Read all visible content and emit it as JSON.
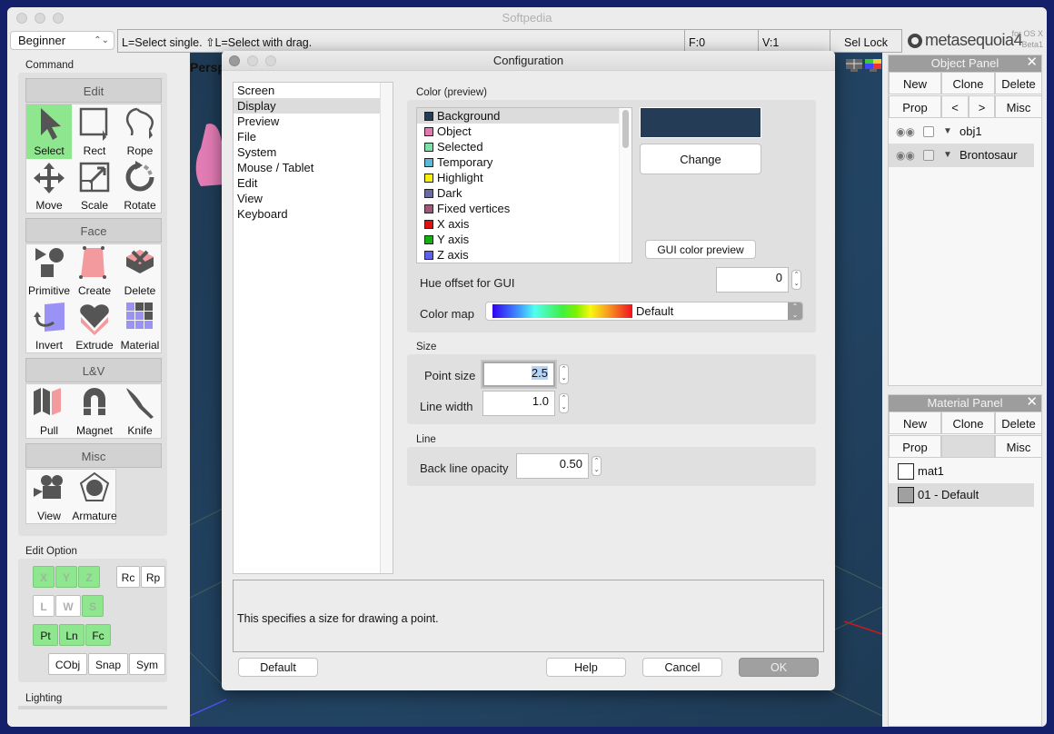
{
  "app": {
    "title": "Softpedia",
    "mode": "Beginner",
    "hint": "L=Select single.  ⇧L=Select with drag.",
    "faces": "F:0",
    "vertices": "V:1",
    "sel_lock": "Sel Lock",
    "logo_name": "metasequoia4",
    "logo_platform": "for OS X",
    "logo_version": "Beta1"
  },
  "command": {
    "label": "Command",
    "groups": [
      {
        "title": "Edit",
        "tools": [
          {
            "label": "Select",
            "icon": "cursor-icon",
            "active": true
          },
          {
            "label": "Rect",
            "icon": "rect-select-icon"
          },
          {
            "label": "Rope",
            "icon": "lasso-icon"
          },
          {
            "label": "Move",
            "icon": "move-icon"
          },
          {
            "label": "Scale",
            "icon": "scale-icon"
          },
          {
            "label": "Rotate",
            "icon": "rotate-icon"
          }
        ]
      },
      {
        "title": "Face",
        "tools": [
          {
            "label": "Primitive",
            "icon": "primitive-icon"
          },
          {
            "label": "Create",
            "icon": "create-face-icon"
          },
          {
            "label": "Delete",
            "icon": "delete-face-icon"
          },
          {
            "label": "Invert",
            "icon": "invert-icon"
          },
          {
            "label": "Extrude",
            "icon": "extrude-icon"
          },
          {
            "label": "Material",
            "icon": "material-icon"
          }
        ]
      },
      {
        "title": "L&V",
        "tools": [
          {
            "label": "Pull",
            "icon": "pull-icon"
          },
          {
            "label": "Magnet",
            "icon": "magnet-icon"
          },
          {
            "label": "Knife",
            "icon": "knife-icon"
          }
        ]
      },
      {
        "title": "Misc",
        "tools": [
          {
            "label": "View",
            "icon": "camera-icon"
          },
          {
            "label": "Armature",
            "icon": "armature-icon"
          }
        ]
      }
    ]
  },
  "edit_option": {
    "label": "Edit Option",
    "axes": [
      "X",
      "Y",
      "Z"
    ],
    "rc": "Rc",
    "rp": "Rp",
    "space": [
      "L",
      "W",
      "S"
    ],
    "elements": [
      "Pt",
      "Ln",
      "Fc"
    ],
    "extra": [
      "CObj",
      "Snap",
      "Sym"
    ]
  },
  "lighting_label": "Lighting",
  "viewport": {
    "label": "Persp"
  },
  "object_panel": {
    "title": "Object Panel",
    "buttons": [
      "New",
      "Clone",
      "Delete",
      "Prop",
      "<",
      ">",
      "Misc"
    ],
    "objects": [
      {
        "name": "obj1",
        "selected": false
      },
      {
        "name": "Brontosaur",
        "selected": true
      }
    ]
  },
  "material_panel": {
    "title": "Material Panel",
    "buttons": [
      "New",
      "Clone",
      "Delete",
      "Prop",
      "Misc"
    ],
    "materials": [
      {
        "name": "mat1",
        "color": "#ffffff",
        "selected": false
      },
      {
        "name": "01 - Default",
        "color": "#a0a0a0",
        "selected": true
      }
    ]
  },
  "dialog": {
    "title": "Configuration",
    "categories": [
      "Screen",
      "Display",
      "Preview",
      "File",
      "System",
      "Mouse / Tablet",
      "Edit",
      "View",
      "Keyboard"
    ],
    "selected_category": "Display",
    "color_section": "Color (preview)",
    "colors": [
      {
        "name": "Background",
        "swatch": "#243c55"
      },
      {
        "name": "Object",
        "swatch": "#e07ab0"
      },
      {
        "name": "Selected",
        "swatch": "#7ee0a8"
      },
      {
        "name": "Temporary",
        "swatch": "#5ab8d8"
      },
      {
        "name": "Highlight",
        "swatch": "#f8f010"
      },
      {
        "name": "Dark",
        "swatch": "#6a6aa0"
      },
      {
        "name": "Fixed vertices",
        "swatch": "#a05878"
      },
      {
        "name": "X axis",
        "swatch": "#e01010"
      },
      {
        "name": "Y axis",
        "swatch": "#10b010"
      },
      {
        "name": "Z axis",
        "swatch": "#6060f0"
      }
    ],
    "preview_color": "#243c55",
    "change_label": "Change",
    "gui_preview_label": "GUI color preview",
    "hue_offset_label": "Hue offset for GUI",
    "hue_offset_value": "0",
    "color_map_label": "Color map",
    "color_map_value": "Default",
    "size_section": "Size",
    "point_size_label": "Point size",
    "point_size_value": "2.5",
    "line_width_label": "Line width",
    "line_width_value": "1.0",
    "line_section": "Line",
    "back_line_label": "Back line opacity",
    "back_line_value": "0.50",
    "description": "This specifies a size for drawing a point.",
    "default_label": "Default",
    "help_label": "Help",
    "cancel_label": "Cancel",
    "ok_label": "OK"
  }
}
